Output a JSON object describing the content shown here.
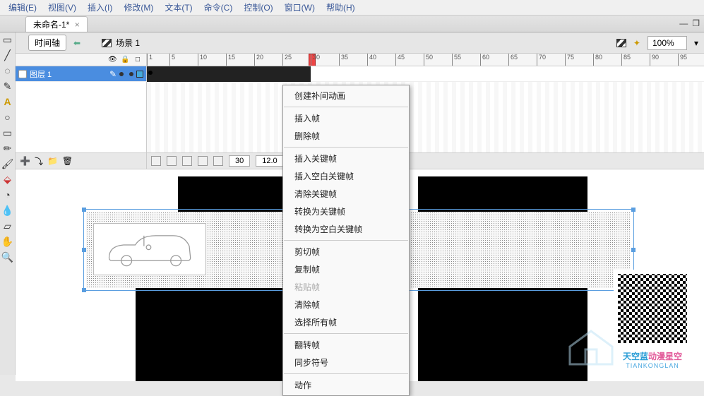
{
  "menu": {
    "edit": "编辑(E)",
    "view": "视图(V)",
    "insert": "插入(I)",
    "modify": "修改(M)",
    "text": "文本(T)",
    "command": "命令(C)",
    "control": "控制(O)",
    "window": "窗口(W)",
    "help": "帮助(H)"
  },
  "document": {
    "tab_title": "未命名-1*"
  },
  "scene": {
    "timeline_button": "时间轴",
    "scene_label": "场景 1",
    "zoom": "100%"
  },
  "timeline": {
    "ticks": [
      "1",
      "5",
      "10",
      "15",
      "20",
      "25",
      "30",
      "35",
      "40",
      "45",
      "50",
      "55",
      "60",
      "65",
      "70",
      "75",
      "80",
      "85",
      "90",
      "95"
    ],
    "playhead_frame": 30
  },
  "layers": {
    "items": [
      {
        "name": "图层 1",
        "selected": true
      }
    ]
  },
  "timeline_status": {
    "current_frame": "30",
    "fps": "12.0"
  },
  "context_menu": {
    "items": [
      {
        "label": "创建补间动画",
        "enabled": true,
        "sep_after": true
      },
      {
        "label": "插入帧",
        "enabled": true
      },
      {
        "label": "删除帧",
        "enabled": true,
        "sep_after": true
      },
      {
        "label": "插入关键帧",
        "enabled": true
      },
      {
        "label": "插入空白关键帧",
        "enabled": true
      },
      {
        "label": "清除关键帧",
        "enabled": true
      },
      {
        "label": "转换为关键帧",
        "enabled": true
      },
      {
        "label": "转换为空白关键帧",
        "enabled": true,
        "sep_after": true
      },
      {
        "label": "剪切帧",
        "enabled": true
      },
      {
        "label": "复制帧",
        "enabled": true
      },
      {
        "label": "粘贴帧",
        "enabled": false
      },
      {
        "label": "清除帧",
        "enabled": true
      },
      {
        "label": "选择所有帧",
        "enabled": true,
        "sep_after": true
      },
      {
        "label": "翻转帧",
        "enabled": true
      },
      {
        "label": "同步符号",
        "enabled": true,
        "sep_after": true
      },
      {
        "label": "动作",
        "enabled": true
      }
    ]
  },
  "watermark": {
    "brand": "天空蓝",
    "brand_suffix": "动漫星空",
    "sub": "TIANKONGLAN"
  }
}
